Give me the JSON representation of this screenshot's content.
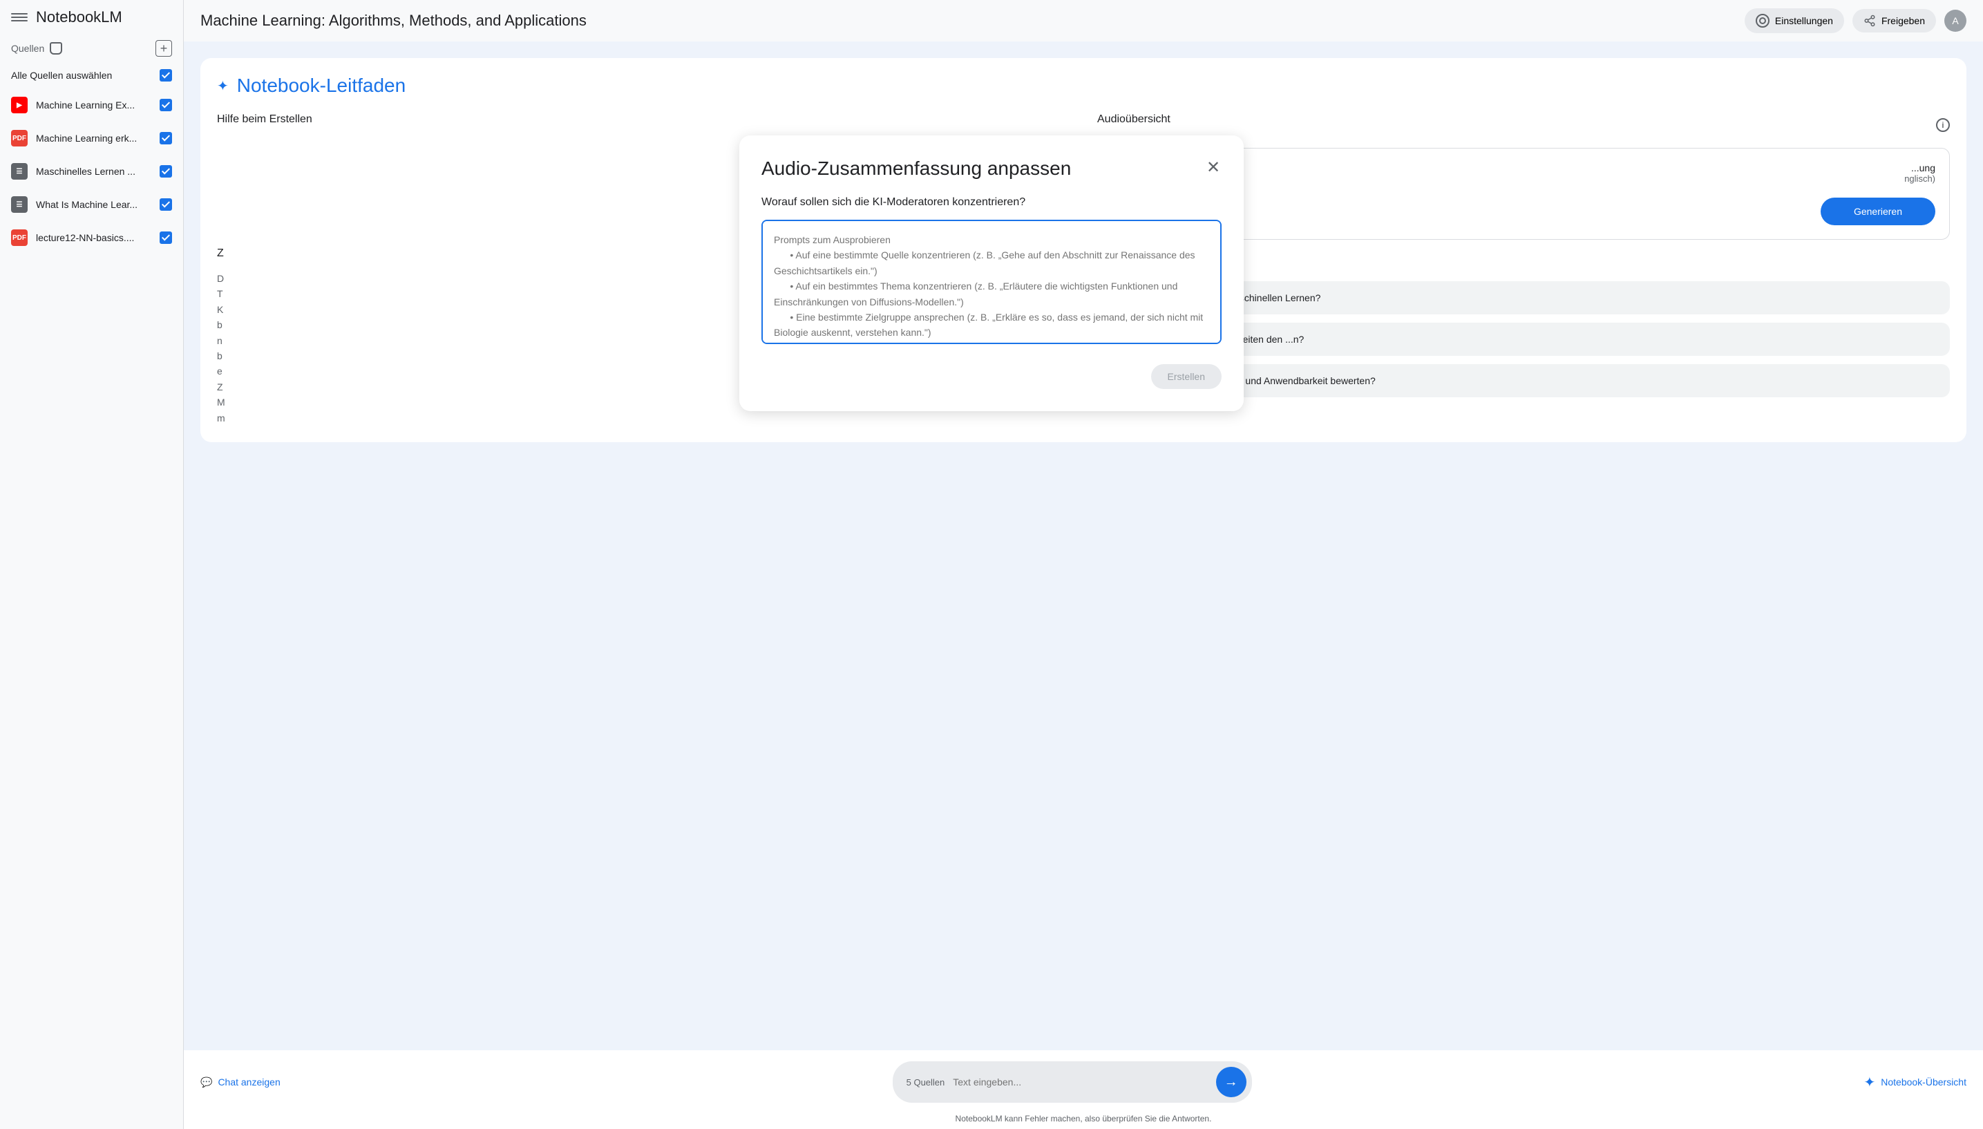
{
  "app": {
    "logo": "NotebookLM",
    "title": "Machine Learning: Algorithms, Methods, and Applications"
  },
  "header": {
    "settings": "Einstellungen",
    "share": "Freigeben",
    "avatar": "A"
  },
  "sidebar": {
    "sources_label": "Quellen",
    "select_all": "Alle Quellen auswählen",
    "sources": [
      {
        "name": "Machine Learning Ex...",
        "type": "youtube"
      },
      {
        "name": "Machine Learning erk...",
        "type": "pdf"
      },
      {
        "name": "Maschinelles Lernen ...",
        "type": "doc"
      },
      {
        "name": "What Is Machine Lear...",
        "type": "doc"
      },
      {
        "name": "lecture12-NN-basics....",
        "type": "pdf"
      }
    ]
  },
  "guide": {
    "title": "Notebook-Leitfaden",
    "help_title": "Hilfe beim Erstellen",
    "summary_title": "Z...",
    "summary_text": "D... T... K... b... n... b... e... Z... M... m...",
    "audio_title": "Audioübersicht",
    "audio_subtitle_partial": "...ung",
    "audio_lang": "nglisch)",
    "generate": "Generieren",
    "suggestions": [
      "...edene Algorithmen die ... maschinellen Lernen?",
      "...n und ethischen Aspekte begleiten den ...n?",
      "...elle hinsichtlich ihrer Leistung und Anwendbarkeit bewerten?"
    ]
  },
  "footer": {
    "chat": "Chat anzeigen",
    "source_count": "5 Quellen",
    "input_placeholder": "Text eingeben...",
    "overview": "Notebook-Übersicht",
    "disclaimer": "NotebookLM kann Fehler machen, also überprüfen Sie die Antworten."
  },
  "modal": {
    "title": "Audio-Zusammenfassung anpassen",
    "label": "Worauf sollen sich die KI-Moderatoren konzentrieren?",
    "placeholder": "Prompts zum Ausprobieren\n      • Auf eine bestimmte Quelle konzentrieren (z. B. „Gehe auf den Abschnitt zur Renaissance des Geschichtsartikels ein.\")\n      • Auf ein bestimmtes Thema konzentrieren (z. B. „Erläutere die wichtigsten Funktionen und Einschränkungen von Diffusions-Modellen.\")\n      • Eine bestimmte Zielgruppe ansprechen (z. B. „Erkläre es so, dass es jemand, der sich nicht mit Biologie auskennt, verstehen kann.\")",
    "create": "Erstellen"
  }
}
